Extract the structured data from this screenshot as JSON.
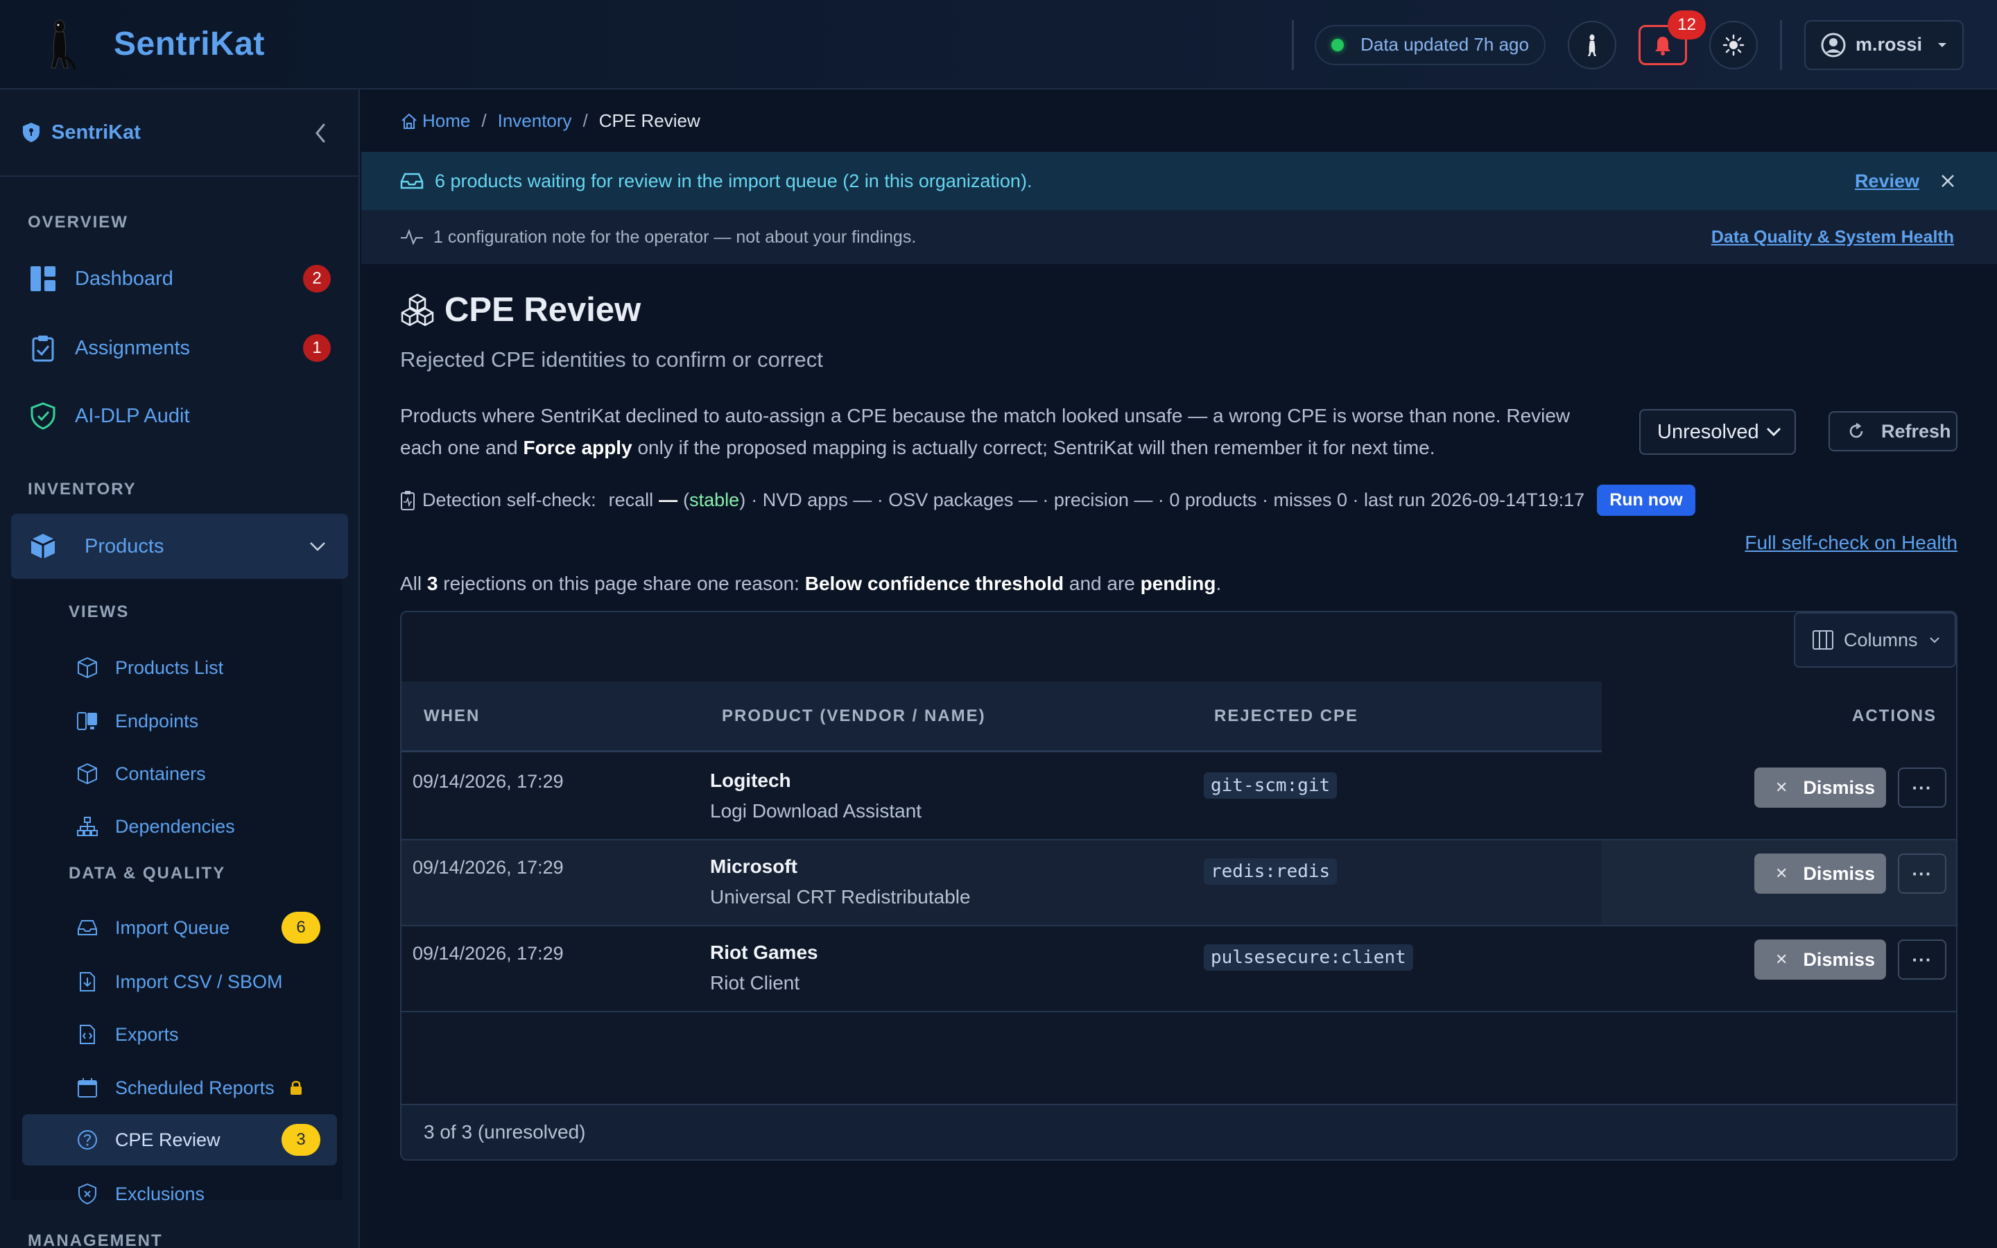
{
  "app": {
    "title": "SentriKat",
    "status_text": "Data updated 7h ago",
    "notifications_count": "12",
    "user_name": "m.rossi"
  },
  "sidebar": {
    "title": "SentriKat",
    "sections": {
      "overview": "OVERVIEW",
      "inventory": "INVENTORY",
      "management": "MANAGEMENT"
    },
    "items": {
      "dashboard": {
        "label": "Dashboard",
        "badge": "2"
      },
      "assignments": {
        "label": "Assignments",
        "badge": "1"
      },
      "aidlp": {
        "label": "AI-DLP Audit"
      },
      "products": {
        "label": "Products"
      }
    },
    "sub_sections": {
      "views": "VIEWS",
      "data_quality": "DATA & QUALITY"
    },
    "sub_items": {
      "products_list": "Products List",
      "endpoints": "Endpoints",
      "containers": "Containers",
      "dependencies": "Dependencies",
      "import_queue": {
        "label": "Import Queue",
        "badge": "6"
      },
      "import_csv": "Import CSV / SBOM",
      "exports": "Exports",
      "scheduled_reports": "Scheduled Reports",
      "cpe_review": {
        "label": "CPE Review",
        "badge": "3"
      },
      "exclusions": "Exclusions"
    }
  },
  "breadcrumb": {
    "home": "Home",
    "inventory": "Inventory",
    "current": "CPE Review",
    "separator": "/"
  },
  "banner": {
    "text": "6 products waiting for review in the import queue (2 in this organization).",
    "link": "Review"
  },
  "note": {
    "text": "1 configuration note for the operator — not about your findings.",
    "link": "Data Quality & System Health"
  },
  "page": {
    "title": "CPE Review",
    "subtitle": "Rejected CPE identities to confirm or correct",
    "desc_part1": "Products where SentriKat declined to auto-assign a CPE because the match looked unsafe — a wrong CPE is worse than none. Review each one and ",
    "desc_bold": "Force apply",
    "desc_part2": " only if the proposed mapping is actually correct; SentriKat will then remember it for next time.",
    "filter_value": "Unresolved",
    "refresh_label": "Refresh"
  },
  "selfcheck": {
    "label": "Detection self-check:",
    "recall_text": "recall",
    "recall_value": "—",
    "stable_open": "(",
    "stable": "stable",
    "stable_close": ")",
    "rest": "· NVD apps — · OSV packages — · precision — · 0 products · misses 0 · last run 2026-09-14T19:17",
    "run_now": "Run now",
    "full_link": "Full self-check on Health"
  },
  "summary": {
    "prefix": "All ",
    "count": "3",
    "middle": " rejections on this page share one reason: ",
    "reason": "Below confidence threshold",
    "and_are": " and are ",
    "status": "pending",
    "suffix": "."
  },
  "table": {
    "columns_button": "Columns",
    "headers": {
      "when": "WHEN",
      "product": "PRODUCT (VENDOR / NAME)",
      "rejected_cpe": "REJECTED CPE",
      "actions": "ACTIONS"
    },
    "rows": [
      {
        "when": "09/14/2026, 17:29",
        "vendor": "Logitech",
        "name": "Logi Download Assistant",
        "cpe": "git-scm:git",
        "action": "Dismiss"
      },
      {
        "when": "09/14/2026, 17:29",
        "vendor": "Microsoft",
        "name": "Universal CRT Redistributable",
        "cpe": "redis:redis",
        "action": "Dismiss"
      },
      {
        "when": "09/14/2026, 17:29",
        "vendor": "Riot Games",
        "name": "Riot Client",
        "cpe": "pulsesecure:client",
        "action": "Dismiss"
      }
    ],
    "footer": "3 of 3 (unresolved)"
  },
  "colors": {
    "accent": "#5ea2ef",
    "badge_red": "#b91c1c",
    "badge_yellow": "#facc15",
    "run_blue": "#2563eb",
    "status_green": "#22c55e"
  }
}
